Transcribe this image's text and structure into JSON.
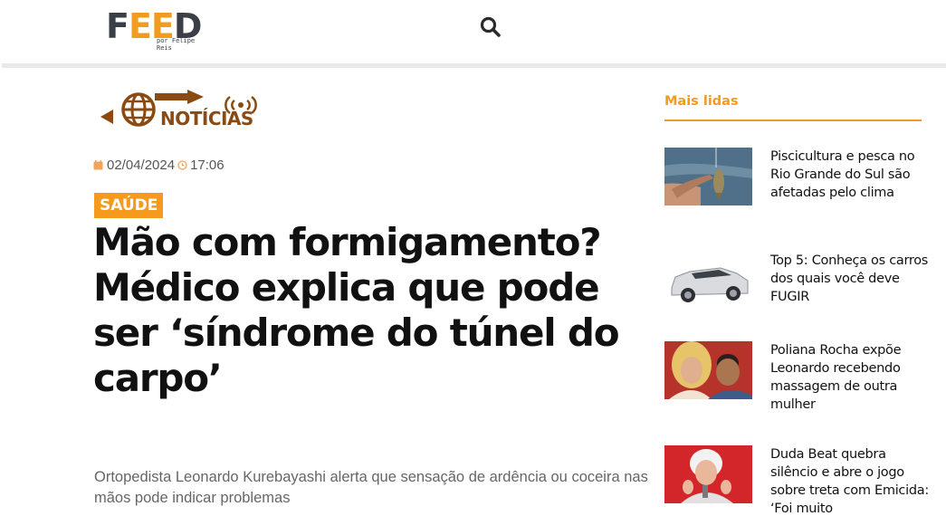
{
  "header": {
    "logo_main": "FEED",
    "logo_sub": "por Felipe Reis"
  },
  "section": {
    "label": "NOTÍCIAS"
  },
  "article": {
    "date": "02/04/2024",
    "time": "17:06",
    "category": "SAÚDE",
    "title": "Mão com formigamento? Médico explica que pode ser ‘síndrome do túnel do carpo’",
    "subtitle": "Ortopedista Leonardo Kurebayashi alerta que sensação de ardência ou coceira nas mãos pode indicar problemas"
  },
  "sidebar": {
    "title": "Mais lidas",
    "items": [
      {
        "title": "Piscicultura e pesca no Rio Grande do Sul são afetadas pelo clima"
      },
      {
        "title": "Top 5: Conheça os carros dos quais você deve FUGIR"
      },
      {
        "title": "Poliana Rocha expõe Leonardo recebendo massagem de outra mulher"
      },
      {
        "title": "Duda Beat quebra silêncio e abre o jogo sobre treta com Emicida: ‘Foi muito"
      }
    ]
  },
  "colors": {
    "accent": "#f29c1f",
    "section_brown": "#8a4a12",
    "text_dark": "#111111"
  }
}
